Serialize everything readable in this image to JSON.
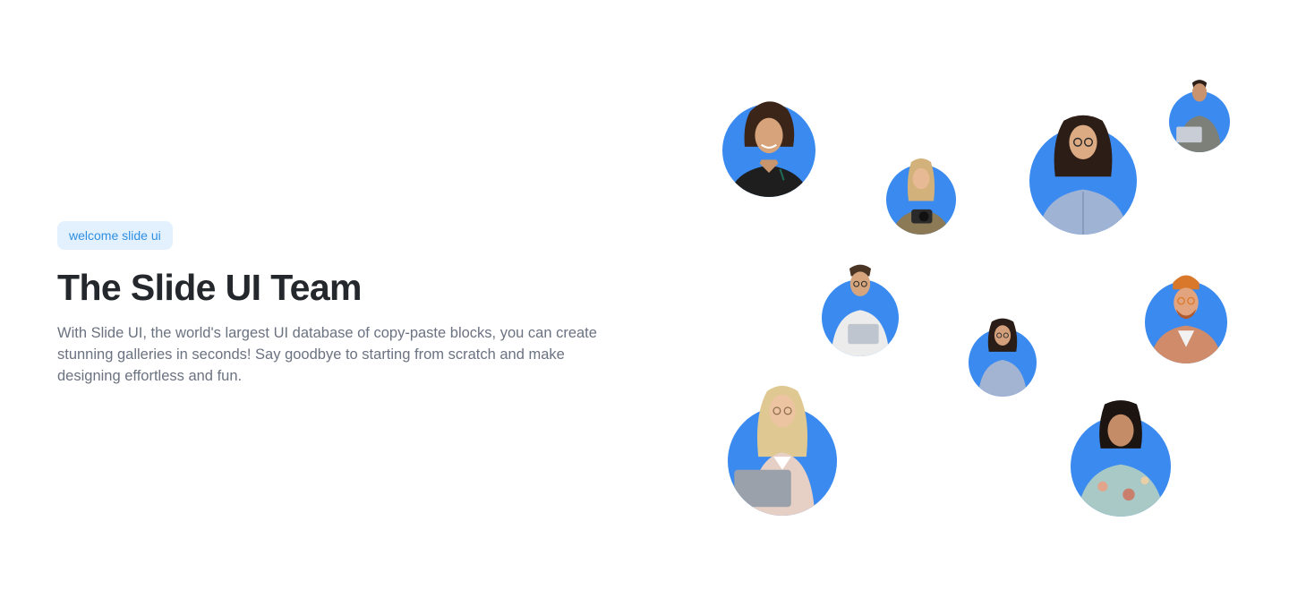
{
  "hero": {
    "badge": "welcome slide ui",
    "title": "The Slide UI Team",
    "description": "With Slide UI, the world's largest UI database of copy-paste blocks, you can create stunning galleries in seconds! Say goodbye to starting from scratch and make designing effortless and fun."
  },
  "colors": {
    "avatar_background": "#3a8af0",
    "badge_background": "#e3f1ff",
    "badge_text": "#2f8fe2",
    "title_text": "#24272b",
    "description_text": "#6b7280"
  },
  "team_avatars": [
    {
      "name": "woman-black-shirt-photo"
    },
    {
      "name": "woman-with-camera-photo"
    },
    {
      "name": "woman-glasses-blue-shirt-photo"
    },
    {
      "name": "man-with-laptop-photo"
    },
    {
      "name": "man-glasses-laptop-photo"
    },
    {
      "name": "woman-glasses-small-photo"
    },
    {
      "name": "man-orange-beanie-photo"
    },
    {
      "name": "woman-holding-laptop-photo"
    },
    {
      "name": "woman-patterned-shirt-photo"
    }
  ]
}
